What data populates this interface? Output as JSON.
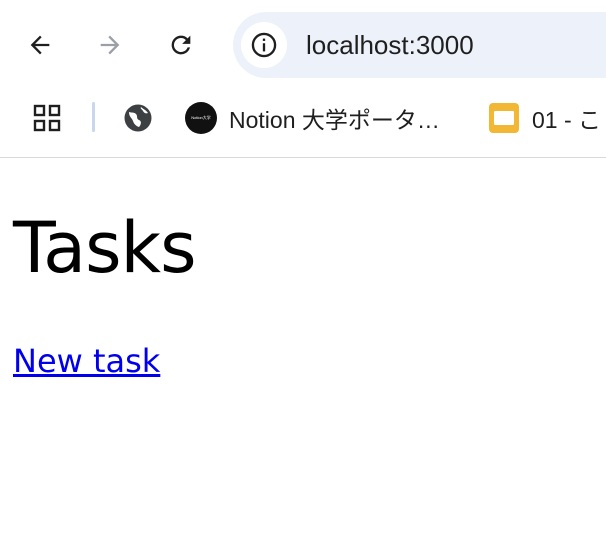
{
  "browser": {
    "url": "localhost:3000",
    "bookmarks": [
      {
        "label": "Notion 大学ポータ…",
        "logo_text": "Notion大学"
      },
      {
        "label": "01 - こ"
      }
    ]
  },
  "page": {
    "heading": "Tasks",
    "new_task_link": "New task"
  },
  "colors": {
    "omnibox_bg": "#edf2fa",
    "link": "#0000ee",
    "slides_yellow": "#f2b835",
    "forward_disabled": "#9aa0a6"
  },
  "icons": [
    "back-arrow-icon",
    "forward-arrow-icon",
    "reload-icon",
    "info-icon",
    "apps-grid-icon",
    "globe-icon",
    "notion-logo-icon",
    "slides-icon"
  ]
}
